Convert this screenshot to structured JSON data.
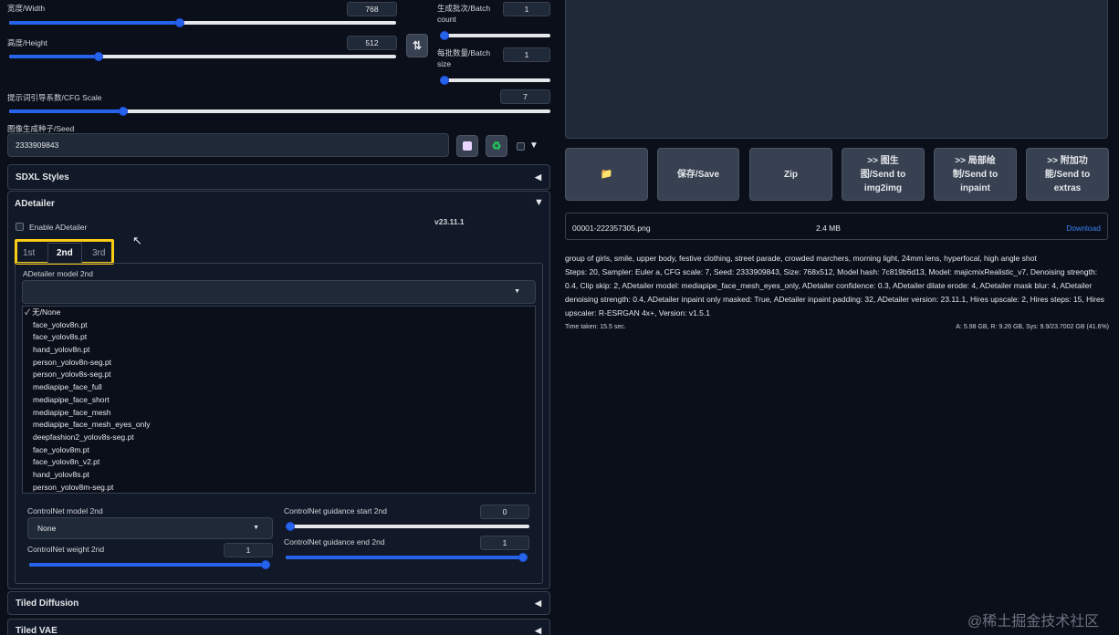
{
  "width": {
    "label": "宽度/Width",
    "value": "768",
    "fraction": 0.44
  },
  "height": {
    "label": "高度/Height",
    "value": "512",
    "fraction": 0.23
  },
  "batch_count": {
    "label": "生成批次/Batch count",
    "label_line1": "生成批次/Batch",
    "label_line2": "count",
    "value": "1",
    "fraction": 0
  },
  "batch_size": {
    "label": "每批数量/Batch size",
    "label_line1": "每批数量/Batch",
    "label_line2": "size",
    "value": "1",
    "fraction": 0
  },
  "cfg": {
    "label": "提示词引导系数/CFG Scale",
    "value": "7",
    "fraction": 0.21
  },
  "seed": {
    "label": "图像生成种子/Seed",
    "value": "2333909843"
  },
  "accordions": {
    "sdxl": "SDXL Styles",
    "adetailer": "ADetailer",
    "tiled_diffusion": "Tiled Diffusion",
    "tiled_vae": "Tiled VAE"
  },
  "adetailer": {
    "enable_label": "Enable ADetailer",
    "version": "v23.11.1",
    "tabs": [
      "1st",
      "2nd",
      "3rd"
    ],
    "model_label": "ADetailer model 2nd",
    "dropdown_options": [
      "✓ 无/None",
      "face_yolov8n.pt",
      "face_yolov8s.pt",
      "hand_yolov8n.pt",
      "person_yolov8n-seg.pt",
      "person_yolov8s-seg.pt",
      "mediapipe_face_full",
      "mediapipe_face_short",
      "mediapipe_face_mesh",
      "mediapipe_face_mesh_eyes_only",
      "deepfashion2_yolov8s-seg.pt",
      "face_yolov8m.pt",
      "face_yolov8n_v2.pt",
      "hand_yolov8s.pt",
      "person_yolov8m-seg.pt"
    ],
    "cn_model_label": "ControlNet model 2nd",
    "cn_model_value": "None",
    "cn_weight_label": "ControlNet weight 2nd",
    "cn_weight_value": "1",
    "cn_weight_fraction": 1,
    "cn_start_label": "ControlNet guidance start 2nd",
    "cn_start_value": "0",
    "cn_start_fraction": 0,
    "cn_end_label": "ControlNet guidance end 2nd",
    "cn_end_value": "1",
    "cn_end_fraction": 1
  },
  "output_buttons": {
    "folder_icon": "📁",
    "save": "保存/Save",
    "zip": "Zip",
    "img2img": [
      ">> 图生",
      "图/Send to",
      "img2img"
    ],
    "inpaint": [
      ">> 局部绘",
      "制/Send to",
      "inpaint"
    ],
    "extras": [
      ">> 附加功",
      "能/Send to",
      "extras"
    ]
  },
  "file": {
    "name": "00001-222357305.png",
    "size": "2.4 MB",
    "download": "Download"
  },
  "info": {
    "prompt": "group of girls, smile, upper body, festive clothing, street parade, crowded marchers, morning light, 24mm lens, hyperfocal, high angle shot",
    "params": "Steps: 20, Sampler: Euler a, CFG scale: 7, Seed: 2333909843, Size: 768x512, Model hash: 7c819b6d13, Model: majicmixRealistic_v7, Denoising strength: 0.4, Clip skip: 2, ADetailer model: mediapipe_face_mesh_eyes_only, ADetailer confidence: 0.3, ADetailer dilate erode: 4, ADetailer mask blur: 4, ADetailer denoising strength: 0.4, ADetailer inpaint only masked: True, ADetailer inpaint padding: 32, ADetailer version: 23.11.1, Hires upscale: 2, Hires steps: 15, Hires upscaler: R-ESRGAN 4x+, Version: v1.5.1",
    "time": "Time taken: 15.5 sec.",
    "vram": "A: 5.98 GB, R: 9.26 GB, Sys: 9.9/23.7002 GB (41.6%)"
  },
  "watermark": "@稀土掘金技术社区",
  "colors": {
    "accent": "#2563eb",
    "highlight": "#facc15",
    "background": "#0b0f19"
  }
}
